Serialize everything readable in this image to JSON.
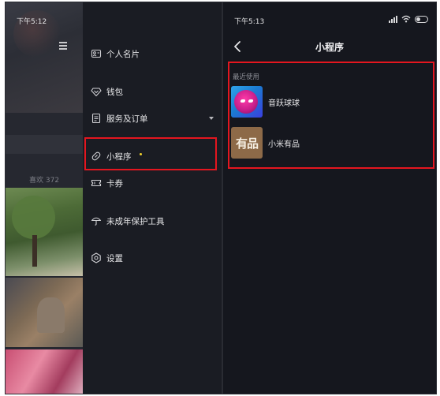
{
  "left_screen": {
    "status_time": "下午5:12",
    "likes_text": "喜欢 372",
    "menu": [
      {
        "id": "business-card",
        "icon": "person-card-icon",
        "label": "个人名片"
      },
      {
        "id": "wallet",
        "icon": "wallet-icon",
        "label": "钱包"
      },
      {
        "id": "orders",
        "icon": "document-icon",
        "label": "服务及订单",
        "has_dropdown": true
      },
      {
        "id": "mini-programs",
        "icon": "link-icon",
        "label": "小程序",
        "has_new_badge": true,
        "badge_color": "#f2d22c",
        "highlighted": true
      },
      {
        "id": "coupons",
        "icon": "ticket-icon",
        "label": "卡券"
      },
      {
        "id": "minor-protection",
        "icon": "umbrella-icon",
        "label": "未成年保护工具"
      },
      {
        "id": "settings",
        "icon": "gear-icon",
        "label": "设置"
      }
    ]
  },
  "right_screen": {
    "status_time": "下午5:13",
    "title": "小程序",
    "section_title": "最近使用",
    "apps": [
      {
        "name": "音跃球球",
        "icon": "music-ball-icon"
      },
      {
        "name": "小米有品",
        "icon": "youpin-icon",
        "icon_text": "有品"
      }
    ]
  },
  "colors": {
    "background": "#15171e",
    "menu_background": "#1a1c23",
    "highlight": "#e4161f",
    "new_badge": "#f2d22c"
  }
}
